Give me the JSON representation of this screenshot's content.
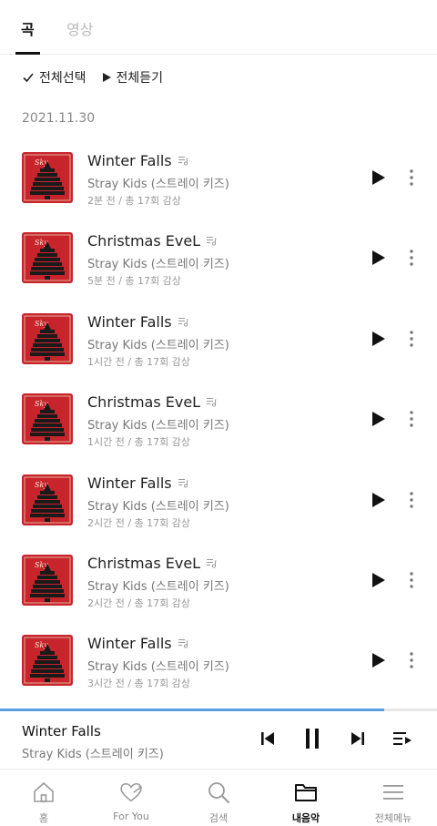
{
  "tabs": [
    {
      "label": "곡",
      "active": true
    },
    {
      "label": "영상",
      "active": false
    }
  ],
  "actions": {
    "select_all": "전체선택",
    "play_all": "전체듣기"
  },
  "date_header": "2021.11.30",
  "tracks": [
    {
      "title": "Winter Falls",
      "artist": "Stray Kids (스트레이 키즈)",
      "meta": "2분 전 / 총 17회 감상"
    },
    {
      "title": "Christmas EveL",
      "artist": "Stray Kids (스트레이 키즈)",
      "meta": "5분 전 / 총 17회 감상"
    },
    {
      "title": "Winter Falls",
      "artist": "Stray Kids (스트레이 키즈)",
      "meta": "1시간 전 / 총 17회 감상"
    },
    {
      "title": "Christmas EveL",
      "artist": "Stray Kids (스트레이 키즈)",
      "meta": "1시간 전 / 총 17회 감상"
    },
    {
      "title": "Winter Falls",
      "artist": "Stray Kids (스트레이 키즈)",
      "meta": "2시간 전 / 총 17회 감상"
    },
    {
      "title": "Christmas EveL",
      "artist": "Stray Kids (스트레이 키즈)",
      "meta": "2시간 전 / 총 17회 감상"
    },
    {
      "title": "Winter Falls",
      "artist": "Stray Kids (스트레이 키즈)",
      "meta": "3시간 전 / 총 17회 감상"
    }
  ],
  "player": {
    "title": "Winter Falls",
    "artist": "Stray Kids (스트레이 키즈)",
    "progress_fraction": 0.88
  },
  "nav": [
    {
      "label": "홈",
      "icon": "home-icon",
      "active": false
    },
    {
      "label": "For You",
      "icon": "heart-icon",
      "active": false
    },
    {
      "label": "검색",
      "icon": "search-icon",
      "active": false
    },
    {
      "label": "내음악",
      "icon": "folder-icon",
      "active": true
    },
    {
      "label": "전체메뉴",
      "icon": "menu-icon",
      "active": false
    }
  ],
  "colors": {
    "accent_progress": "#5a9fe0",
    "album_red": "#c8242b",
    "text_primary": "#222222",
    "text_secondary": "#777777"
  }
}
